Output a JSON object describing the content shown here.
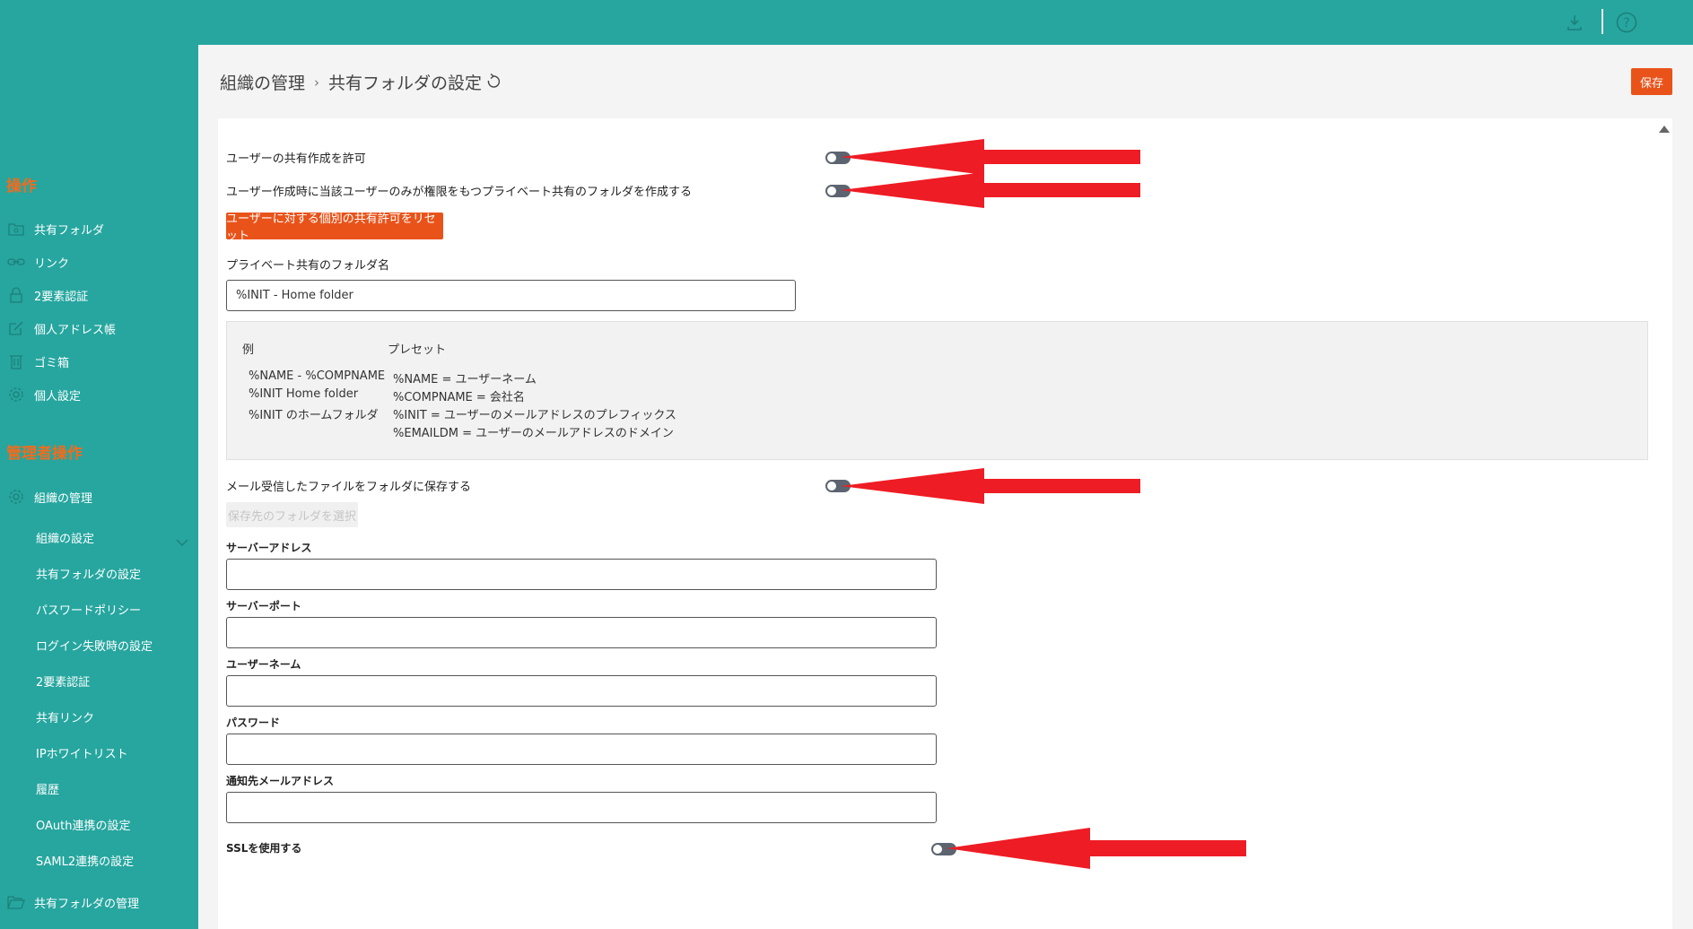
{
  "header": {
    "download_icon": "download-icon",
    "help_icon": "help-icon"
  },
  "sidebar": {
    "section_operations": "操作",
    "operations": [
      {
        "label": "共有フォルダ",
        "icon": "shared-folder-icon"
      },
      {
        "label": "リンク",
        "icon": "link-icon"
      },
      {
        "label": "2要素認証",
        "icon": "lock-icon"
      },
      {
        "label": "個人アドレス帳",
        "icon": "edit-icon"
      },
      {
        "label": "ゴミ箱",
        "icon": "trash-icon"
      },
      {
        "label": "個人設定",
        "icon": "gear-icon"
      }
    ],
    "section_admin": "管理者操作",
    "admin_group": {
      "label": "組織の管理",
      "icon": "gear-icon"
    },
    "admin_items": [
      {
        "label": "組織の設定"
      },
      {
        "label": "共有フォルダの設定"
      },
      {
        "label": "パスワードポリシー"
      },
      {
        "label": "ログイン失敗時の設定"
      },
      {
        "label": "2要素認証"
      },
      {
        "label": "共有リンク"
      },
      {
        "label": "IPホワイトリスト"
      },
      {
        "label": "履歴"
      },
      {
        "label": "OAuth連携の設定"
      },
      {
        "label": "SAML2連携の設定"
      }
    ],
    "shared_folder_mgmt": {
      "label": "共有フォルダの管理",
      "icon": "folder-open-icon"
    }
  },
  "page": {
    "breadcrumb_parent": "組織の管理",
    "breadcrumb_current": "共有フォルダの設定",
    "save_label": "保存"
  },
  "form": {
    "allow_user_share_label": "ユーザーの共有作成を許可",
    "create_private_folder_label": "ユーザー作成時に当該ユーザーのみが権限をもつプライベート共有のフォルダを作成する",
    "reset_button_label": "ユーザーに対する個別の共有許可をリセット",
    "private_folder_name_label": "プライベート共有のフォルダ名",
    "private_folder_name_value": "%INIT - Home folder",
    "preset": {
      "example_header": "例",
      "preset_header": "プレセット",
      "examples": [
        "%NAME - %COMPNAME",
        "%INIT Home folder",
        "%INIT のホームフォルダ"
      ],
      "presets": [
        "%NAME = ユーザーネーム",
        "%COMPNAME = 会社名",
        "%INIT = ユーザーのメールアドレスのプレフィックス",
        "%EMAILDM = ユーザーのメールアドレスのドメイン"
      ]
    },
    "save_mail_files_label": "メール受信したファイルをフォルダに保存する",
    "select_folder_button": "保存先のフォルダを選択",
    "server_address_label": "サーバーアドレス",
    "server_port_label": "サーバーポート",
    "username_label": "ユーザーネーム",
    "password_label": "パスワード",
    "notify_email_label": "通知先メールアドレス",
    "ssl_label": "SSLを使用する",
    "server_address_value": "",
    "server_port_value": "",
    "username_value": "",
    "password_value": "",
    "notify_email_value": ""
  },
  "colors": {
    "teal": "#26a69f",
    "orange": "#e9531a",
    "arrow_red": "#ee1c24"
  }
}
